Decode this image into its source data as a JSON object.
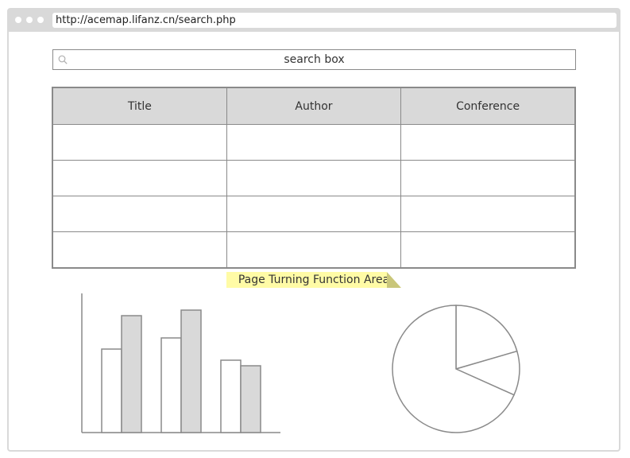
{
  "browser": {
    "url": "http://acemap.lifanz.cn/search.php"
  },
  "search": {
    "placeholder": "search box"
  },
  "table": {
    "columns": [
      "Title",
      "Author",
      "Conference"
    ],
    "rows": [
      [
        "",
        "",
        ""
      ],
      [
        "",
        "",
        ""
      ],
      [
        "",
        "",
        ""
      ],
      [
        "",
        "",
        ""
      ]
    ]
  },
  "pagination": {
    "label": "Page Turning Function Area"
  },
  "colors": {
    "chrome": "#d9d9d9",
    "border": "#8a8a8a",
    "sticky": "#fffba6",
    "bar_fill_shaded": "#d9d9d9"
  },
  "chart_data": [
    {
      "type": "bar",
      "categories": [
        "",
        "",
        ""
      ],
      "series": [
        {
          "values": [
            15,
            17
          ]
        },
        {
          "values": [
            21,
            22
          ]
        }
      ],
      "bar_groups": [
        [
          15,
          21
        ],
        [
          17,
          22
        ],
        [
          13,
          12
        ]
      ],
      "ylim": [
        0,
        25
      ],
      "title": "",
      "xlabel": "",
      "ylabel": "",
      "grid": false
    },
    {
      "type": "pie",
      "slices": [
        0.205,
        0.112,
        0.683
      ],
      "title": ""
    }
  ]
}
